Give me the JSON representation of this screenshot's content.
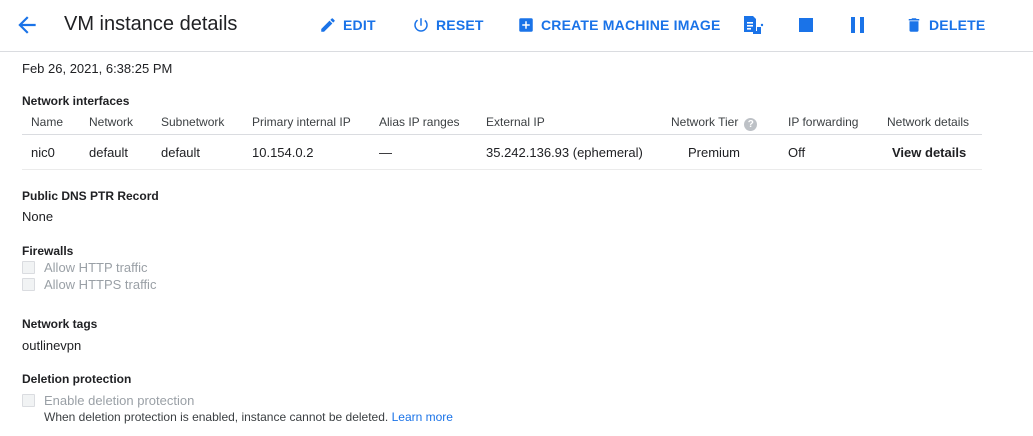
{
  "header": {
    "title": "VM instance details",
    "actions": {
      "edit": "EDIT",
      "reset": "RESET",
      "create_image": "CREATE MACHINE IMAGE",
      "delete": "DELETE"
    }
  },
  "timestamp": "Feb 26, 2021, 6:38:25 PM",
  "network_interfaces": {
    "label": "Network interfaces",
    "columns": [
      "Name",
      "Network",
      "Subnetwork",
      "Primary internal IP",
      "Alias IP ranges",
      "External IP",
      "Network Tier",
      "IP forwarding",
      "Network details"
    ],
    "rows": [
      {
        "name": "nic0",
        "network": "default",
        "subnetwork": "default",
        "primary_ip": "10.154.0.2",
        "alias_ip": "—",
        "external_ip": "35.242.136.93 (ephemeral)",
        "tier": "Premium",
        "ip_forwarding": "Off",
        "details_link": "View details"
      }
    ]
  },
  "dns": {
    "label": "Public DNS PTR Record",
    "value": "None"
  },
  "firewalls": {
    "label": "Firewalls",
    "options": [
      {
        "label": "Allow HTTP traffic",
        "checked": false
      },
      {
        "label": "Allow HTTPS traffic",
        "checked": false
      }
    ]
  },
  "network_tags": {
    "label": "Network tags",
    "value": "outlinevpn"
  },
  "deletion_protection": {
    "label": "Deletion protection",
    "checkbox_label": "Enable deletion protection",
    "hint": "When deletion protection is enabled, instance cannot be deleted.",
    "learn_more": "Learn more"
  },
  "icons": {
    "back": "arrow-back-icon",
    "edit": "pencil-icon",
    "reset": "power-icon",
    "create_image": "add-box-icon",
    "ssh": "ssh-terminal-icon",
    "stop": "stop-icon",
    "suspend": "pause-icon",
    "delete": "trash-icon",
    "help": "help-circle-icon"
  },
  "colors": {
    "accent": "#1a73e8",
    "text": "#202124",
    "disabled": "#9aa0a6"
  }
}
